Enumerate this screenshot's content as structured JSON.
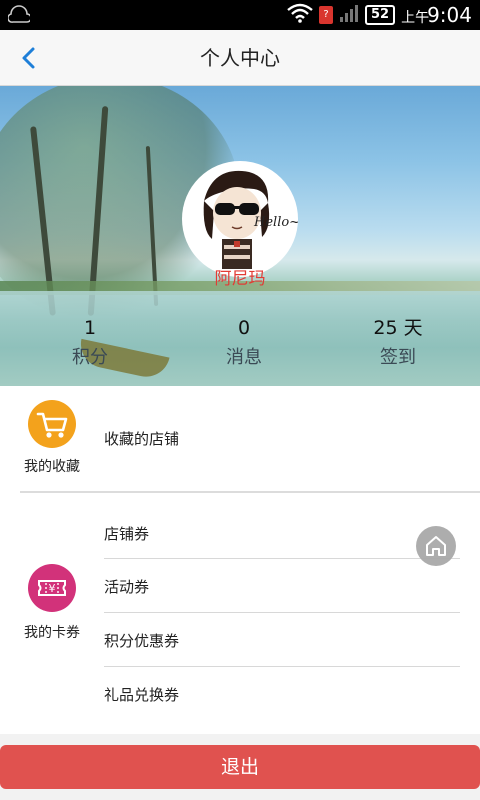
{
  "status_bar": {
    "battery": "52",
    "ampm": "上午",
    "time": "9:04",
    "sim_badge": "?"
  },
  "nav": {
    "title": "个人中心",
    "back_icon": "chevron-left-icon"
  },
  "profile": {
    "username": "阿尼玛",
    "avatar_text": "Hello~",
    "stats": [
      {
        "value": "1",
        "label": "积分"
      },
      {
        "value": "0",
        "label": "消息"
      },
      {
        "value": "25 天",
        "label": "签到"
      }
    ]
  },
  "favorites": {
    "group_label": "我的收藏",
    "icon": "shopping-cart-icon",
    "icon_color": "#f3a21c",
    "items": [
      "收藏的店铺"
    ]
  },
  "coupons": {
    "group_label": "我的卡券",
    "icon": "ticket-icon",
    "icon_color": "#d2327a",
    "icon_glyph": "¥",
    "items": [
      "店铺券",
      "活动券",
      "积分优惠券",
      "礼品兑换券"
    ]
  },
  "home_fab": {
    "icon": "home-icon"
  },
  "logout": {
    "label": "退出",
    "color": "#e0524f"
  },
  "accent": "#1e7fd8"
}
